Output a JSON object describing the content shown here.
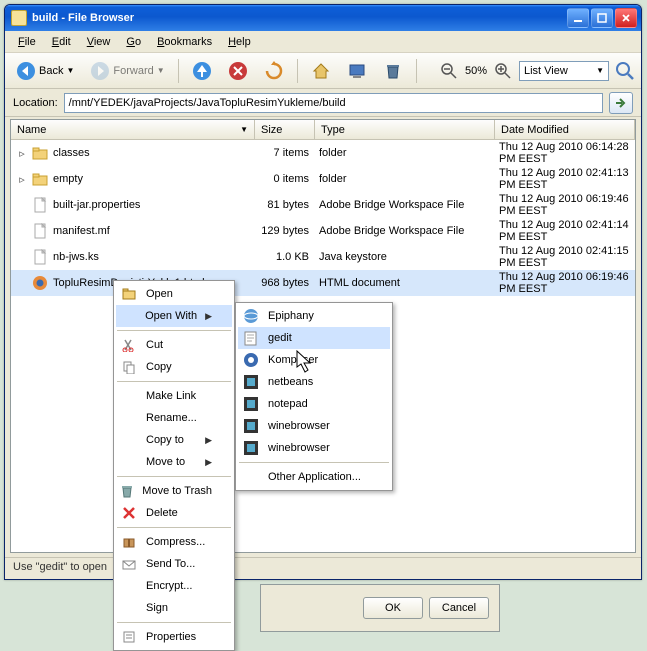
{
  "title": "build - File Browser",
  "menus": [
    "File",
    "Edit",
    "View",
    "Go",
    "Bookmarks",
    "Help"
  ],
  "toolbar": {
    "back": "Back",
    "forward": "Forward",
    "zoom": "50%",
    "view": "List View"
  },
  "location": {
    "label": "Location:",
    "value": "/mnt/YEDEK/javaProjects/JavaTopluResimYukleme/build"
  },
  "columns": {
    "name": "Name",
    "size": "Size",
    "type": "Type",
    "date": "Date Modified"
  },
  "rows": [
    {
      "exp": "▹",
      "icon": "folder",
      "name": "classes",
      "size": "7 items",
      "type": "folder",
      "date": "Thu 12 Aug 2010 06:14:28 PM EEST"
    },
    {
      "exp": "▹",
      "icon": "folder",
      "name": "empty",
      "size": "0 items",
      "type": "folder",
      "date": "Thu 12 Aug 2010 02:41:13 PM EEST"
    },
    {
      "exp": "",
      "icon": "file",
      "name": "built-jar.properties",
      "size": "81 bytes",
      "type": "Adobe Bridge Workspace File",
      "date": "Thu 12 Aug 2010 06:19:46 PM EEST"
    },
    {
      "exp": "",
      "icon": "file",
      "name": "manifest.mf",
      "size": "129 bytes",
      "type": "Adobe Bridge Workspace File",
      "date": "Thu 12 Aug 2010 02:41:14 PM EEST"
    },
    {
      "exp": "",
      "icon": "file",
      "name": "nb-jws.ks",
      "size": "1.0 KB",
      "type": "Java keystore",
      "date": "Thu 12 Aug 2010 02:41:15 PM EEST"
    },
    {
      "exp": "",
      "icon": "html",
      "name": "TopluResimDegistirYukle1.html",
      "size": "968 bytes",
      "type": "HTML document",
      "date": "Thu 12 Aug 2010 06:19:46 PM EEST",
      "sel": true
    }
  ],
  "status": "Use \"gedit\" to open",
  "ctx": {
    "open": "Open",
    "openwith": "Open With",
    "cut": "Cut",
    "copy": "Copy",
    "makelink": "Make Link",
    "rename": "Rename...",
    "copyto": "Copy to",
    "moveto": "Move to",
    "trash": "Move to Trash",
    "delete": "Delete",
    "compress": "Compress...",
    "sendto": "Send To...",
    "encrypt": "Encrypt...",
    "sign": "Sign",
    "properties": "Properties"
  },
  "sub": {
    "epiphany": "Epiphany",
    "gedit": "gedit",
    "komposer": "Komposer",
    "netbeans": "netbeans",
    "notepad": "notepad",
    "winebrowser1": "winebrowser",
    "winebrowser2": "winebrowser",
    "other": "Other Application..."
  },
  "dlg": {
    "ok": "OK",
    "cancel": "Cancel"
  }
}
